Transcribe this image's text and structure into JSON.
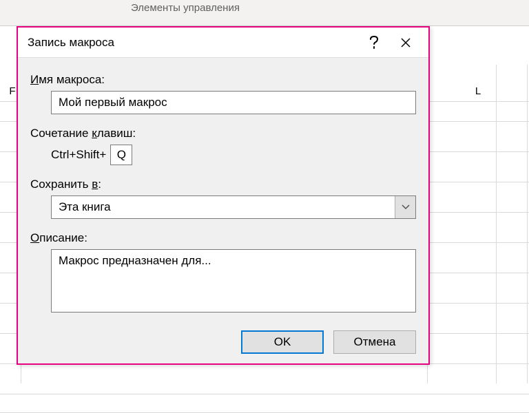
{
  "ribbon": {
    "group_label": "Элементы управления"
  },
  "sheet": {
    "col_f": "F",
    "col_l": "L"
  },
  "dialog": {
    "title": "Запись макроса",
    "name_label_pre": "И",
    "name_label_rest": "мя макроса:",
    "name_value": "Мой первый макрос",
    "shortcut_label_pre": "Сочетание ",
    "shortcut_label_ul": "к",
    "shortcut_label_rest": "лавиш:",
    "shortcut_prefix": "Ctrl+Shift+",
    "shortcut_key": "Q",
    "store_label_pre": "Сохранить ",
    "store_label_ul": "в",
    "store_label_rest": ":",
    "store_value": "Эта книга",
    "desc_label_ul": "О",
    "desc_label_rest": "писание:",
    "desc_value": "Макрос предназначен для...",
    "ok": "OK",
    "cancel": "Отмена"
  }
}
